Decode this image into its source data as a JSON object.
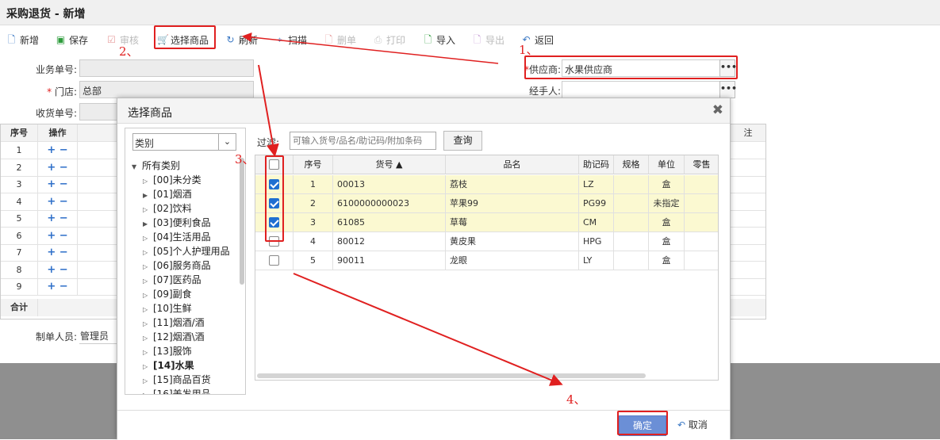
{
  "window": {
    "title": "采购退货 - 新增"
  },
  "toolbar": {
    "new": "新增",
    "save": "保存",
    "audit": "审核",
    "select_goods": "选择商品",
    "refresh": "刷新",
    "scan": "扫描",
    "delete": "删单",
    "print": "打印",
    "import": "导入",
    "export": "导出",
    "back": "返回"
  },
  "form": {
    "order_no_label": "业务单号:",
    "store_label": "门店:",
    "store_value": "总部",
    "receipt_no_label": "收货单号:",
    "supplier_label": "供应商:",
    "supplier_value": "水果供应商",
    "handler_label": "经手人:",
    "creator_label": "制单人员:",
    "creator_value": "管理员",
    "dots": "•••"
  },
  "bg_grid": {
    "headers": [
      "序号",
      "操作"
    ],
    "rows": [
      "1",
      "2",
      "3",
      "4",
      "5",
      "6",
      "7",
      "8",
      "9"
    ],
    "total_label": "合计",
    "right_header": "注",
    "plus": "+",
    "minus": "−"
  },
  "dialog": {
    "title": "选择商品",
    "close": "✖",
    "category_select": "类别",
    "filter_label": "过滤:",
    "filter_placeholder": "可输入货号/品名/助记码/附加条码",
    "query_button": "查询",
    "ok_button": "确定",
    "cancel_button": "取消",
    "tree": {
      "root": "所有类别",
      "items": [
        {
          "label": "[00]未分类",
          "expand": false
        },
        {
          "label": "[01]烟酒",
          "expand": true
        },
        {
          "label": "[02]饮料",
          "expand": false
        },
        {
          "label": "[03]便利食品",
          "expand": true
        },
        {
          "label": "[04]生活用品",
          "expand": false
        },
        {
          "label": "[05]个人护理用品",
          "expand": false
        },
        {
          "label": "[06]服务商品",
          "expand": false
        },
        {
          "label": "[07]医药品",
          "expand": false
        },
        {
          "label": "[09]副食",
          "expand": false
        },
        {
          "label": "[10]生鲜",
          "expand": false
        },
        {
          "label": "[11]烟酒/酒",
          "expand": false
        },
        {
          "label": "[12]烟酒\\酒",
          "expand": false
        },
        {
          "label": "[13]服饰",
          "expand": false
        },
        {
          "label": "[14]水果",
          "expand": false,
          "bold": true
        },
        {
          "label": "[15]商品百货",
          "expand": false
        },
        {
          "label": "[16]美发用品",
          "expand": false
        }
      ]
    },
    "grid": {
      "headers": [
        "序号",
        "货号 ▲",
        "品名",
        "助记码",
        "规格",
        "单位",
        "零售"
      ],
      "rows": [
        {
          "checked": true,
          "no": "1",
          "code": "00013",
          "name": "荔枝",
          "mnemonic": "LZ",
          "spec": "",
          "unit": "盒"
        },
        {
          "checked": true,
          "no": "2",
          "code": "6100000000023",
          "name": "苹果99",
          "mnemonic": "PG99",
          "spec": "",
          "unit": "未指定"
        },
        {
          "checked": true,
          "no": "3",
          "code": "61085",
          "name": "草莓",
          "mnemonic": "CM",
          "spec": "",
          "unit": "盒"
        },
        {
          "checked": false,
          "no": "4",
          "code": "80012",
          "name": "黄皮果",
          "mnemonic": "HPG",
          "spec": "",
          "unit": "盒"
        },
        {
          "checked": false,
          "no": "5",
          "code": "90011",
          "name": "龙眼",
          "mnemonic": "LY",
          "spec": "",
          "unit": "盒"
        }
      ]
    }
  },
  "annotations": {
    "a1": "1、",
    "a2": "2、",
    "a3": "3、",
    "a4": "4、"
  },
  "colors": {
    "annotation_red": "#e02020",
    "ok_blue": "#6b8fd6",
    "selected_row": "#fbf9d1",
    "checkbox_blue": "#1f6fd1"
  }
}
